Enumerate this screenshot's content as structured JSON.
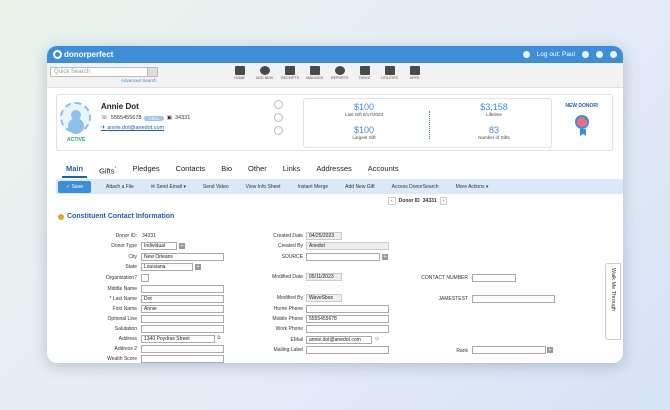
{
  "app": {
    "logo_text": "donorperfect",
    "logout_label": "Log out: Paul"
  },
  "search": {
    "placeholder": "Quick Search",
    "advanced_label": "Advanced Search"
  },
  "nav": [
    {
      "label": "HOME",
      "icon": "home-icon"
    },
    {
      "label": "ADD NEW",
      "icon": "plus-circle-icon"
    },
    {
      "label": "RECEIPTS",
      "icon": "receipt-icon"
    },
    {
      "label": "MAILINGS",
      "icon": "mail-icon"
    },
    {
      "label": "REPORTS",
      "icon": "pie-chart-icon"
    },
    {
      "label": "TASKS",
      "icon": "clipboard-icon"
    },
    {
      "label": "UTILITIES",
      "icon": "wrench-icon"
    },
    {
      "label": "APPS",
      "icon": "grid-icon"
    }
  ],
  "donor": {
    "name": "Annie Dot",
    "phone": "5555455678",
    "phone_type": "CELL",
    "id": "34331",
    "email": "annie.dot@anedot.com",
    "status": "ACTIVE"
  },
  "gifts": {
    "last_gift": "$100",
    "last_gift_label": "Last Gift 5/17/2023",
    "largest_gift": "$100",
    "largest_gift_label": "Largest Gift",
    "lifetime": "$3,158",
    "lifetime_label": "Lifetime",
    "num_gifts": "83",
    "num_gifts_label": "Number of Gifts"
  },
  "new_donor_label": "NEW DONOR!",
  "tabs": [
    "Main",
    "Gifts",
    "Pledges",
    "Contacts",
    "Bio",
    "Other",
    "Links",
    "Addresses",
    "Accounts"
  ],
  "tab_badge": "*",
  "actions": {
    "save": "Save",
    "items": [
      "Attach a File",
      "Send Email",
      "Send Video",
      "View Info Sheet",
      "Instant Merge",
      "Add New Gift",
      "Access DonorSearch",
      "More Actions"
    ]
  },
  "donor_id_nav": {
    "label": "Donor ID",
    "value": "34331"
  },
  "section_title": "Constituent Contact Information",
  "left_fields": [
    {
      "label": "Donor ID:",
      "value": "34331"
    },
    {
      "label": "Donor Type",
      "value": "Individual"
    },
    {
      "label": "City",
      "value": "New Orleans"
    },
    {
      "label": "State",
      "value": "Louisiana"
    },
    {
      "label": "Organization?",
      "value": ""
    },
    {
      "label": "Middle Name",
      "value": ""
    },
    {
      "label": "* Last Name",
      "value": "Dot"
    },
    {
      "label": "First Name",
      "value": "Annie"
    },
    {
      "label": "Optional Line",
      "value": ""
    },
    {
      "label": "Salutation",
      "value": ""
    },
    {
      "label": "Address",
      "value": "1340 Poydras Street"
    },
    {
      "label": "Address 2",
      "value": ""
    },
    {
      "label": "Wealth Score",
      "value": ""
    }
  ],
  "mid_fields": [
    {
      "label": "Created Date",
      "value": "04/25/2023"
    },
    {
      "label": "Created By",
      "value": "Anedot"
    },
    {
      "label": "SOURCE",
      "value": ""
    },
    {
      "label": "Modified Date",
      "value": "05/11/2023"
    },
    {
      "label": "Modified By",
      "value": "WaveSbox"
    },
    {
      "label": "Home Phone",
      "value": ""
    },
    {
      "label": "Mobile Phone",
      "value": "5555455678"
    },
    {
      "label": "Work Phone",
      "value": ""
    },
    {
      "label": "EMail",
      "value": "annie.dot@anedot.com"
    },
    {
      "label": "Mailing Label",
      "value": ""
    }
  ],
  "right_fields": [
    {
      "label": "CONTACT NUMBER",
      "value": ""
    },
    {
      "label": "JAMESTEST",
      "value": ""
    },
    {
      "label": "Rank",
      "value": ""
    }
  ],
  "walkme_label": "Walk Me Through"
}
